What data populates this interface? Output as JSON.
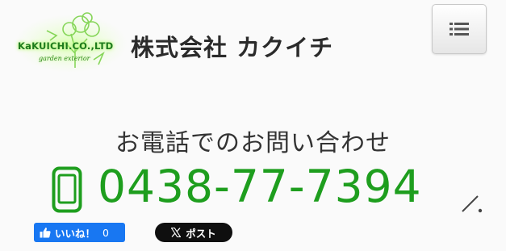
{
  "header": {
    "logo": {
      "text": "KaKUICHI.CO.,LTD",
      "tagline": "garden exterior"
    },
    "company_name": "株式会社 カクイチ",
    "menu_icon": "hamburger-list-icon"
  },
  "contact": {
    "heading": "お電話でのお問い合わせ",
    "phone_icon": "smartphone-icon",
    "phone_number": "0438-77-7394"
  },
  "social": {
    "facebook_like": {
      "label": "いいね！",
      "count": "0"
    },
    "x_post": {
      "label": "ポスト"
    }
  },
  "colors": {
    "accent_green": "#1e9e1e",
    "logo_glow": "#b8ff7a",
    "facebook_blue": "#1877f2",
    "x_black": "#0f0f0f"
  }
}
